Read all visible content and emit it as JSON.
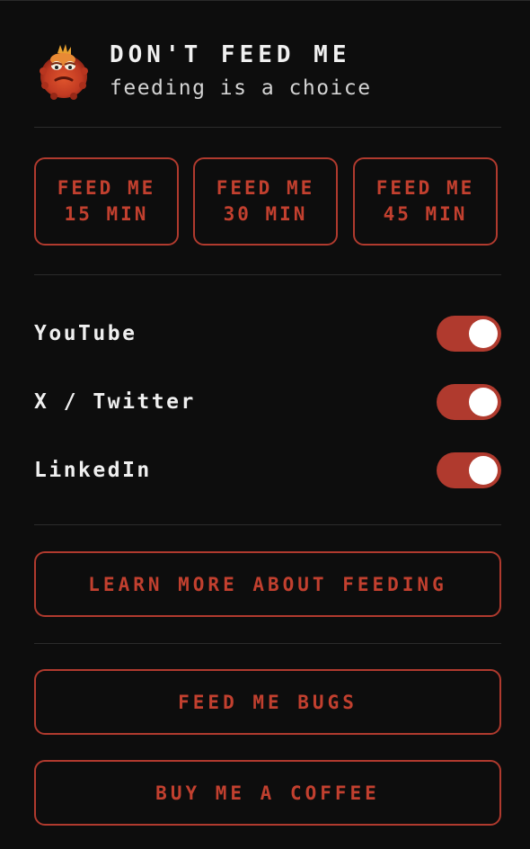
{
  "header": {
    "title": "DON'T FEED ME",
    "subtitle": "feeding is a choice",
    "mascot_icon": "orange-fuzzy-monster"
  },
  "feed_buttons": [
    {
      "line1": "FEED ME",
      "line2": "15 MIN"
    },
    {
      "line1": "FEED ME",
      "line2": "30 MIN"
    },
    {
      "line1": "FEED ME",
      "line2": "45 MIN"
    }
  ],
  "toggles": [
    {
      "label": "YouTube",
      "enabled": true
    },
    {
      "label": "X / Twitter",
      "enabled": true
    },
    {
      "label": "LinkedIn",
      "enabled": true
    }
  ],
  "links": {
    "learn_more": "LEARN MORE ABOUT FEEDING",
    "feed_bugs": "FEED ME BUGS",
    "coffee": "BUY ME A COFFEE"
  },
  "colors": {
    "background": "#0d0d0d",
    "accent": "#b03a2e",
    "accent_text": "#c2402f",
    "text": "#ececec"
  }
}
